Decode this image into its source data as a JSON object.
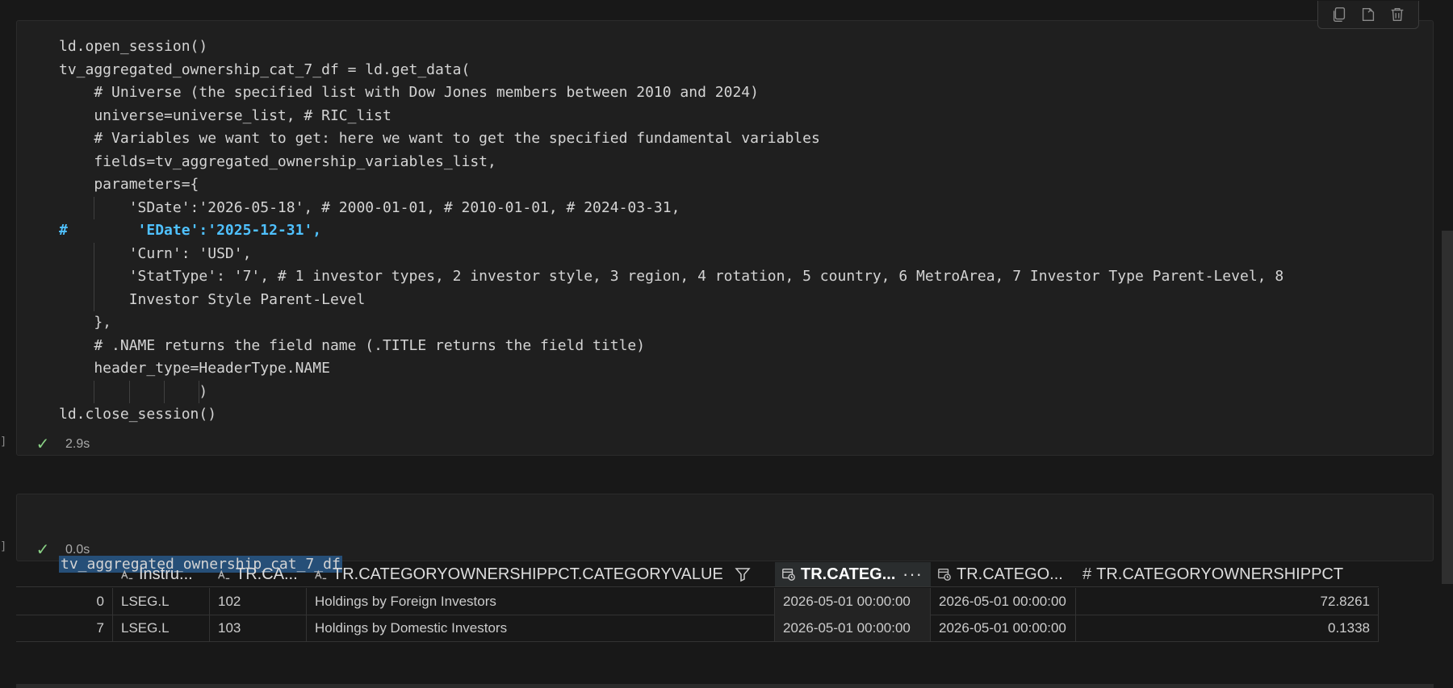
{
  "cell1": {
    "code_lines": [
      "ld.open_session()",
      "tv_aggregated_ownership_cat_7_df = ld.get_data(",
      "    # Universe (the specified list with Dow Jones members between 2010 and 2024)",
      "    universe=universe_list, # RIC_list",
      "    # Variables we want to get: here we want to get the specified fundamental variables",
      "    fields=tv_aggregated_ownership_variables_list,",
      "    parameters={",
      "        'SDate':'2026-05-18', # 2000-01-01, # 2010-01-01, # 2024-03-31,",
      "#        'EDate':'2025-12-31',",
      "        'Curn': 'USD',",
      "        'StatType': '7', # 1 investor types, 2 investor style, 3 region, 4 rotation, 5 country, 6 MetroArea, 7 Investor Type Parent-Level, 8",
      "        Investor Style Parent-Level",
      "    },",
      "    # .NAME returns the field name (.TITLE returns the field title)",
      "    header_type=HeaderType.NAME",
      "                )",
      "ld.close_session()"
    ],
    "edate_hash": "#",
    "edate_text": "'EDate':'2025-12-31',",
    "status_time": "2.9s"
  },
  "cell2": {
    "code": "tv_aggregated_ownership_cat_7_df",
    "status_time": "0.0s"
  },
  "toolbar": {
    "icons": [
      "copy-icon",
      "export-icon",
      "trash-icon"
    ]
  },
  "dataframe": {
    "headers": [
      "Instru...",
      "TR.CA...",
      "TR.CATEGORYOWNERSHIPPCT.CATEGORYVALUE",
      "TR.CATEG...",
      "TR.CATEGO...",
      "TR.CATEGORYOWNERSHIPPCT"
    ],
    "more_label": "···",
    "rows": [
      {
        "index": "0",
        "instrument": "LSEG.L",
        "ca": "102",
        "value": "Holdings by Foreign Investors",
        "d1": "2026-05-01 00:00:00",
        "d2": "2026-05-01 00:00:00",
        "pct": "72.8261"
      },
      {
        "index": "7",
        "instrument": "LSEG.L",
        "ca": "103",
        "value": "Holdings by Domestic Investors",
        "d1": "2026-05-01 00:00:00",
        "d2": "2026-05-01 00:00:00",
        "pct": "0.1338"
      }
    ]
  }
}
